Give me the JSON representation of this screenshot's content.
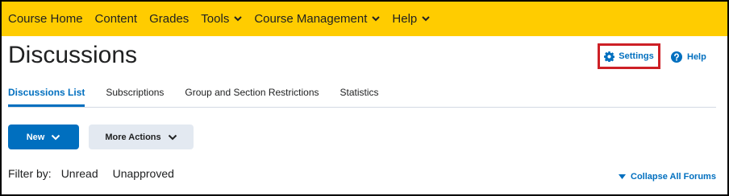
{
  "navbar": {
    "items": [
      {
        "label": "Course Home",
        "has_menu": false
      },
      {
        "label": "Content",
        "has_menu": false
      },
      {
        "label": "Grades",
        "has_menu": false
      },
      {
        "label": "Tools",
        "has_menu": true
      },
      {
        "label": "Course Management",
        "has_menu": true
      },
      {
        "label": "Help",
        "has_menu": true
      }
    ]
  },
  "page": {
    "title": "Discussions",
    "settings_label": "Settings",
    "help_label": "Help"
  },
  "tabs": [
    {
      "label": "Discussions List",
      "active": true
    },
    {
      "label": "Subscriptions",
      "active": false
    },
    {
      "label": "Group and Section Restrictions",
      "active": false
    },
    {
      "label": "Statistics",
      "active": false
    }
  ],
  "actions": {
    "new_label": "New",
    "more_label": "More Actions"
  },
  "filter": {
    "label": "Filter by:",
    "options": [
      "Unread",
      "Unapproved"
    ]
  },
  "collapse_label": "Collapse All Forums",
  "colors": {
    "navbar": "#ffcc00",
    "accent": "#006fbf",
    "highlight": "#cd2026"
  },
  "icons": {
    "settings": "gear-icon",
    "help": "help-circle-icon",
    "dropdown": "chevron-down-icon",
    "collapse": "caret-down-icon"
  }
}
